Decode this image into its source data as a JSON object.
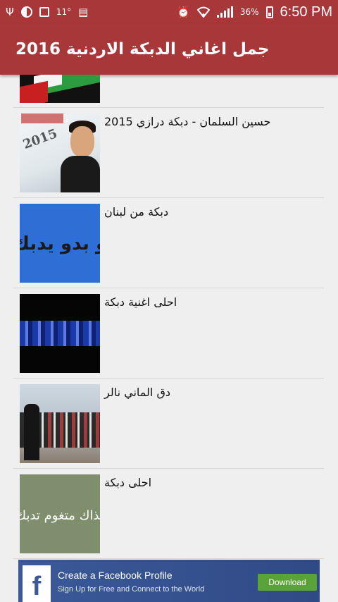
{
  "status_bar": {
    "temperature": "11°",
    "battery_percent": "36%",
    "time": "6:50 PM",
    "icons": [
      "usb-icon",
      "half-moon-icon",
      "image-icon",
      "sd-card-icon",
      "alarm-icon",
      "wifi-icon",
      "signal-icon",
      "battery-icon"
    ]
  },
  "action_bar": {
    "title": "جمل اغاني الدبكة الاردنية 2016"
  },
  "list": {
    "items": [
      {
        "title": ""
      },
      {
        "title": "حسين السلمان - دبكة درازي 2015"
      },
      {
        "title": "دبكة من لبنان"
      },
      {
        "title": "احلى اغنية دبكة"
      },
      {
        "title": "دق الماني نالر"
      },
      {
        "title": "احلى دبكة"
      }
    ],
    "thumb_texts": {
      "blue": "كلو بدو يدبك",
      "green": "احذاك متغوم تدبك",
      "portrait_year": "2015"
    }
  },
  "ad": {
    "title": "Create a Facebook Profile",
    "subtitle": "Sign Up for Free and Connect to the World",
    "button": "Download",
    "brand_color": "#3b5998"
  },
  "colors": {
    "primary": "#a8373a",
    "background": "#efefef",
    "divider": "#d7d7d7"
  }
}
